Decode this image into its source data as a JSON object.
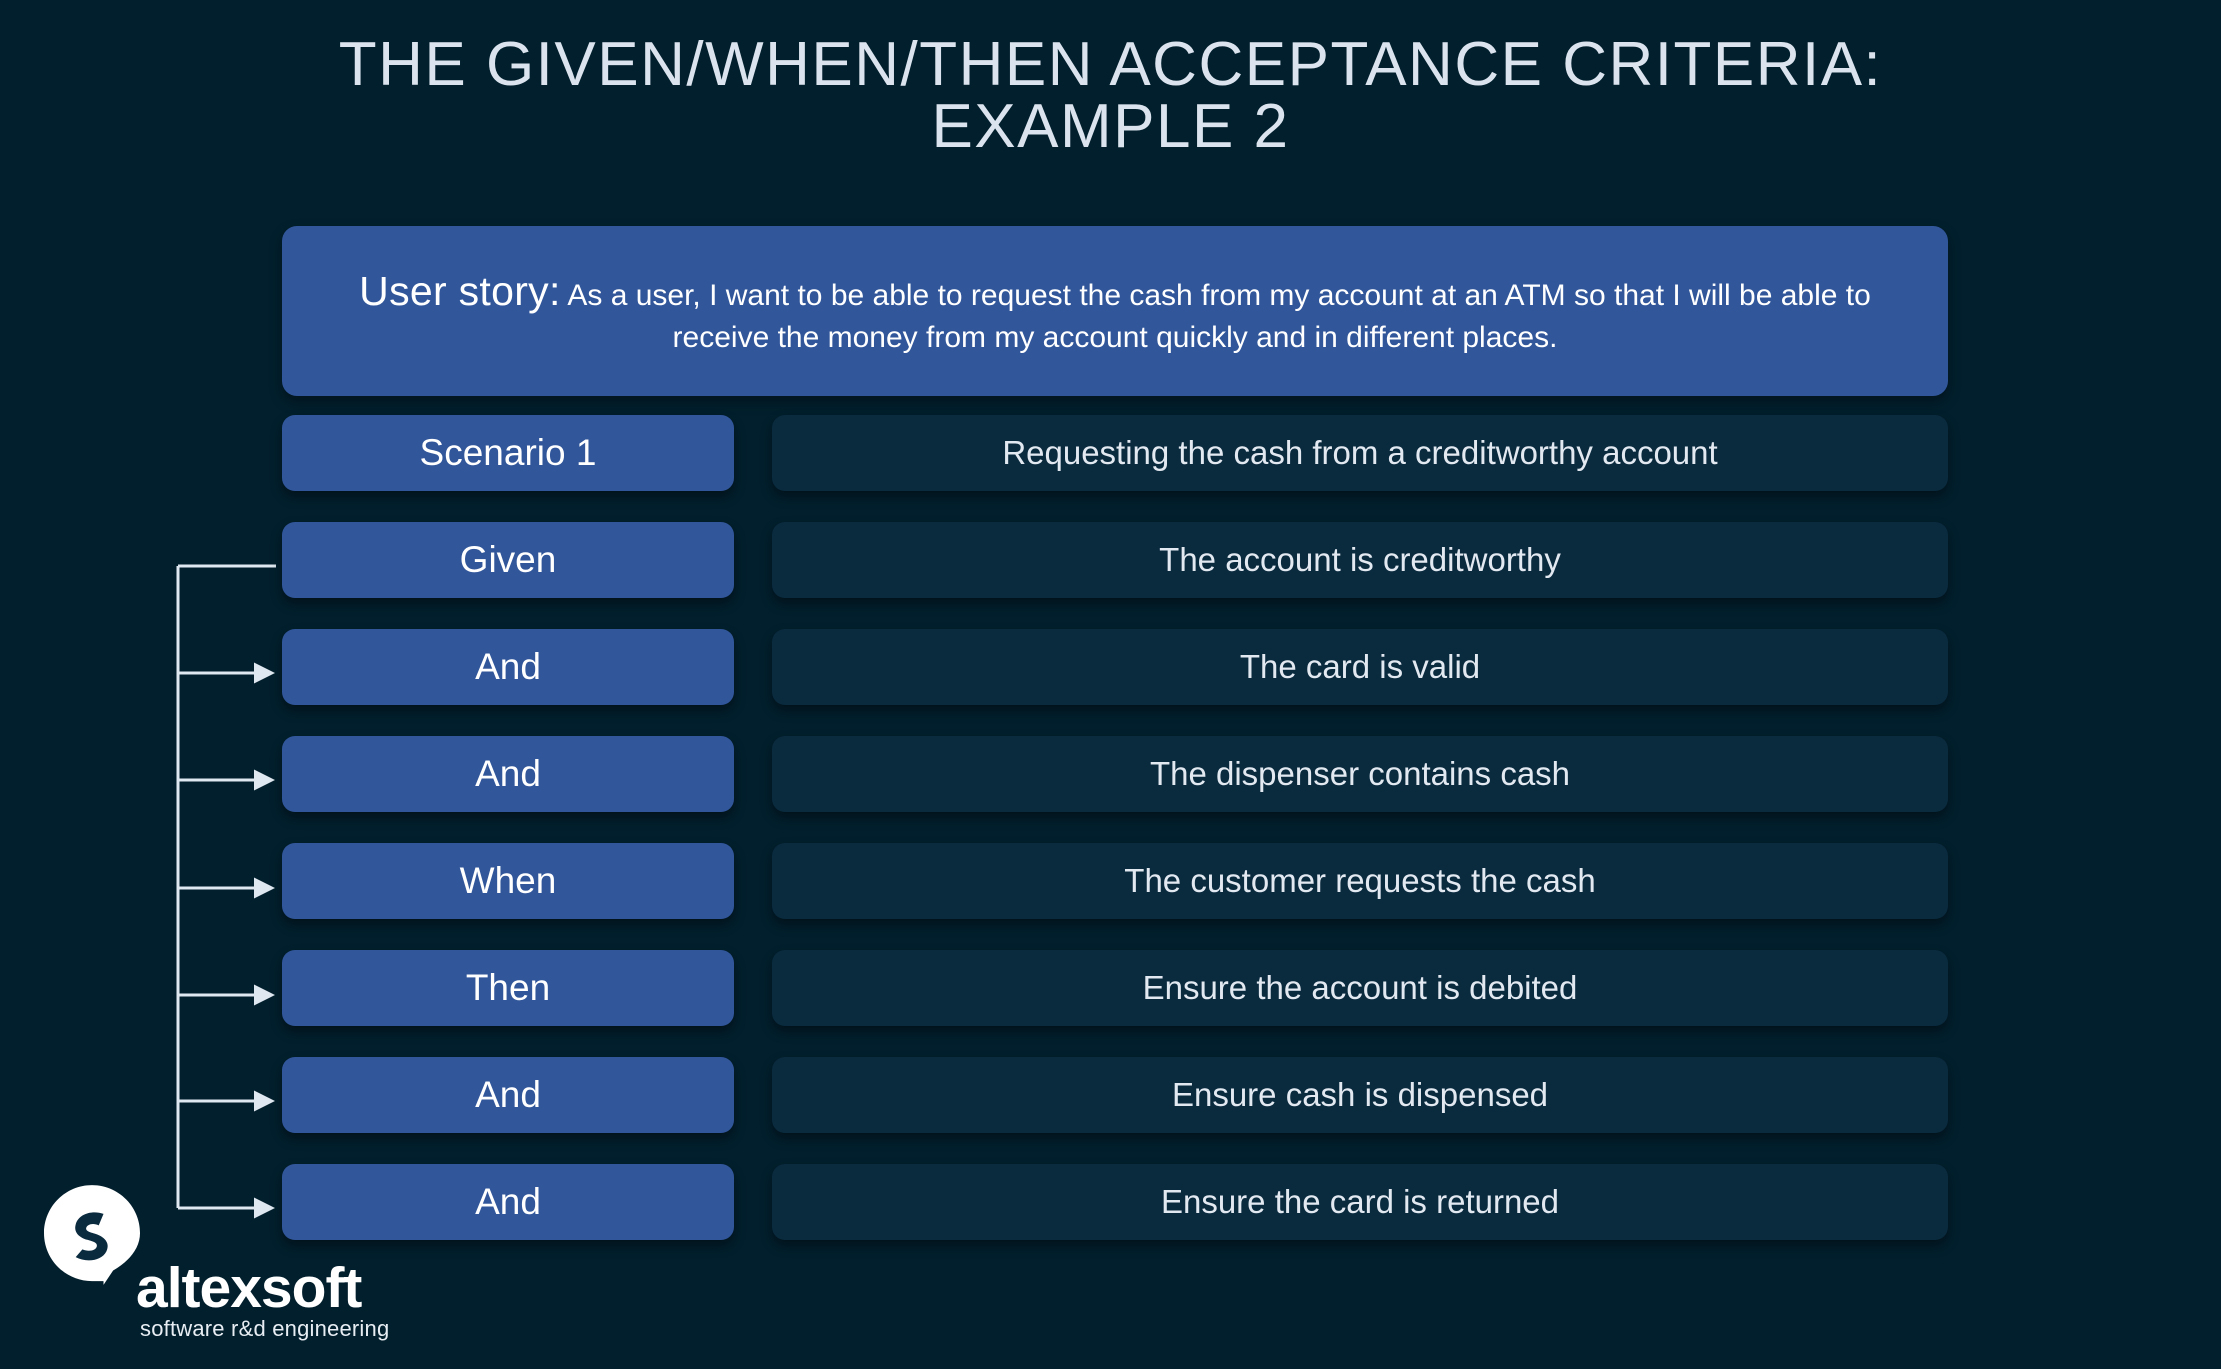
{
  "slide": {
    "title": "THE GIVEN/WHEN/THEN ACCEPTANCE CRITERIA:\nEXAMPLE 2",
    "background_color": "#021f2d",
    "accent_color": "#31569a",
    "panel_color": "#0a2a3e",
    "text_color": "#e3e9f1"
  },
  "user_story": {
    "label": "User story:",
    "text": " As a user, I want to be able to request the cash from my account at an ATM so that I will be able to receive the money from my account quickly and in different places."
  },
  "rows": [
    {
      "label": "Scenario 1",
      "text": "Requesting the cash from a creditworthy account"
    },
    {
      "label": "Given",
      "text": "The account is creditworthy"
    },
    {
      "label": "And",
      "text": "The card is valid"
    },
    {
      "label": "And",
      "text": "The dispenser contains cash"
    },
    {
      "label": "When",
      "text": "The customer requests the cash"
    },
    {
      "label": "Then",
      "text": "Ensure the account is debited"
    },
    {
      "label": "And",
      "text": "Ensure cash is dispensed"
    },
    {
      "label": "And",
      "text": "Ensure the card is returned"
    }
  ],
  "logo": {
    "wordmark": "altexsoft",
    "tagline": "software r&d engineering"
  }
}
